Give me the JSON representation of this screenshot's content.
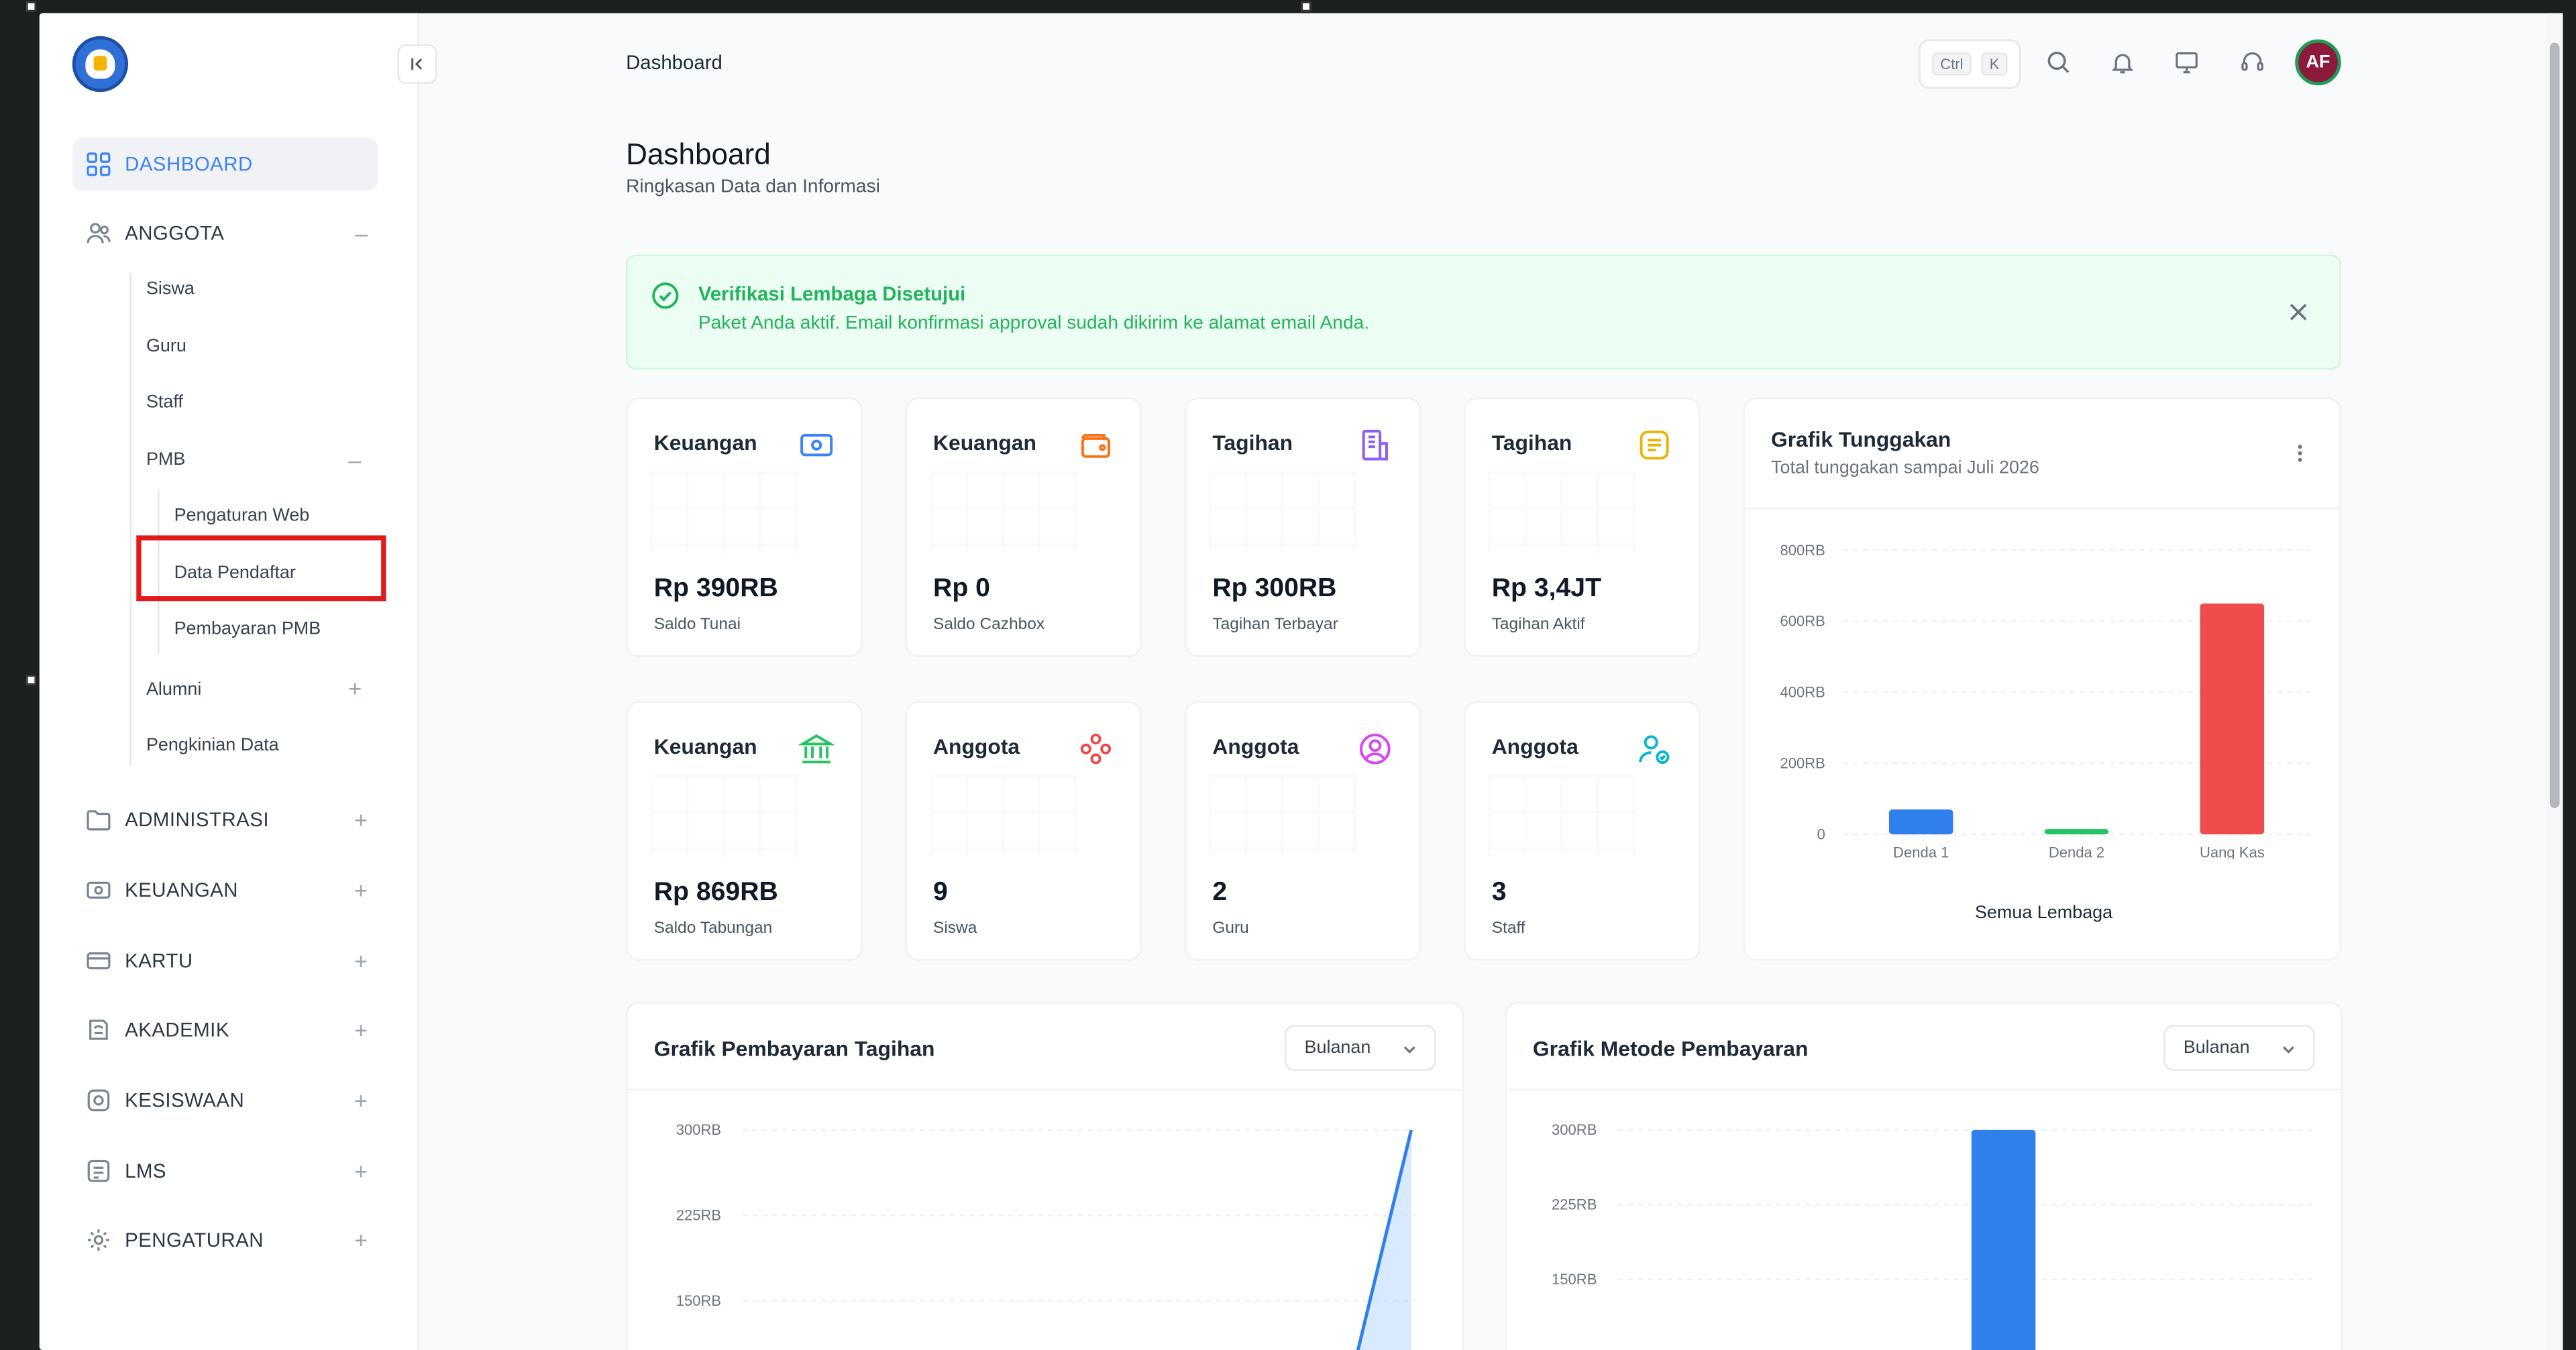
{
  "app": {
    "breadcrumb": "Dashboard",
    "shortcut": {
      "key1": "Ctrl",
      "key2": "K"
    },
    "user_initials": "AF"
  },
  "sidebar": {
    "items": [
      {
        "label": "DASHBOARD",
        "icon": "grid-icon",
        "active": true
      },
      {
        "label": "ANGGOTA",
        "icon": "users-icon",
        "expanded": true
      },
      {
        "label": "ADMINISTRASI",
        "icon": "folder-icon"
      },
      {
        "label": "KEUANGAN",
        "icon": "money-icon"
      },
      {
        "label": "KARTU",
        "icon": "card-icon"
      },
      {
        "label": "AKADEMIK",
        "icon": "academic-icon"
      },
      {
        "label": "KESISWAAN",
        "icon": "student-icon"
      },
      {
        "label": "LMS",
        "icon": "lms-icon"
      },
      {
        "label": "PENGATURAN",
        "icon": "settings-icon"
      }
    ],
    "anggota_sub": [
      "Siswa",
      "Guru",
      "Staff",
      "PMB",
      "Alumni",
      "Pengkinian Data"
    ],
    "pmb_sub": [
      "Pengaturan Web",
      "Data Pendaftar",
      "Pembayaran PMB"
    ]
  },
  "page": {
    "title": "Dashboard",
    "subtitle": "Ringkasan Data dan Informasi"
  },
  "alert": {
    "title": "Verifikasi Lembaga Disetujui",
    "message": "Paket Anda aktif. Email konfirmasi approval sudah dikirim ke alamat email Anda."
  },
  "cards": [
    {
      "title": "Keuangan",
      "value": "Rp 390RB",
      "sub": "Saldo Tunai",
      "icon": "cash-icon",
      "color": "#3b82f6"
    },
    {
      "title": "Keuangan",
      "value": "Rp 0",
      "sub": "Saldo Cazhbox",
      "icon": "wallet-icon",
      "color": "#f97316"
    },
    {
      "title": "Tagihan",
      "value": "Rp 300RB",
      "sub": "Tagihan Terbayar",
      "icon": "invoice-icon",
      "color": "#8b5cf6"
    },
    {
      "title": "Tagihan",
      "value": "Rp 3,4JT",
      "sub": "Tagihan Aktif",
      "icon": "bill-icon",
      "color": "#eab308"
    },
    {
      "title": "Keuangan",
      "value": "Rp 869RB",
      "sub": "Saldo Tabungan",
      "icon": "bank-icon",
      "color": "#22c55e"
    },
    {
      "title": "Anggota",
      "value": "9",
      "sub": "Siswa",
      "icon": "group-icon",
      "color": "#ef4444"
    },
    {
      "title": "Anggota",
      "value": "2",
      "sub": "Guru",
      "icon": "user-circle-icon",
      "color": "#d946ef"
    },
    {
      "title": "Anggota",
      "value": "3",
      "sub": "Staff",
      "icon": "user-check-icon",
      "color": "#06b6d4"
    }
  ],
  "tunggakan": {
    "title": "Grafik Tunggakan",
    "subtitle": "Total tunggakan sampai Juli 2026",
    "footer": "Semua Lembaga"
  },
  "pembayaran": {
    "title": "Grafik Pembayaran Tagihan",
    "select": "Bulanan"
  },
  "metode": {
    "title": "Grafik Metode Pembayaran",
    "select": "Bulanan"
  },
  "chart_data": [
    {
      "type": "bar",
      "title": "Grafik Tunggakan",
      "categories": [
        "Denda 1",
        "Denda 2",
        "Uang Kas"
      ],
      "values": [
        70000,
        15000,
        650000
      ],
      "colors": [
        "#2f80ed",
        "#22c55e",
        "#ef4c4c"
      ],
      "yticks": [
        "0",
        "200RB",
        "400RB",
        "600RB",
        "800RB"
      ],
      "ylim": [
        0,
        800000
      ],
      "xlabel": "Semua Lembaga"
    },
    {
      "type": "area",
      "title": "Grafik Pembayaran Tagihan",
      "yticks": [
        "150RB",
        "225RB",
        "300RB"
      ],
      "ylim": [
        150000,
        300000
      ],
      "note": "line rising to 300RB at the right edge; lower part cropped",
      "values": [
        150000,
        300000
      ]
    },
    {
      "type": "bar",
      "title": "Grafik Metode Pembayaran",
      "yticks": [
        "150RB",
        "225RB",
        "300RB"
      ],
      "ylim": [
        150000,
        300000
      ],
      "values": [
        300000
      ],
      "colors": [
        "#2f80ed"
      ]
    }
  ]
}
